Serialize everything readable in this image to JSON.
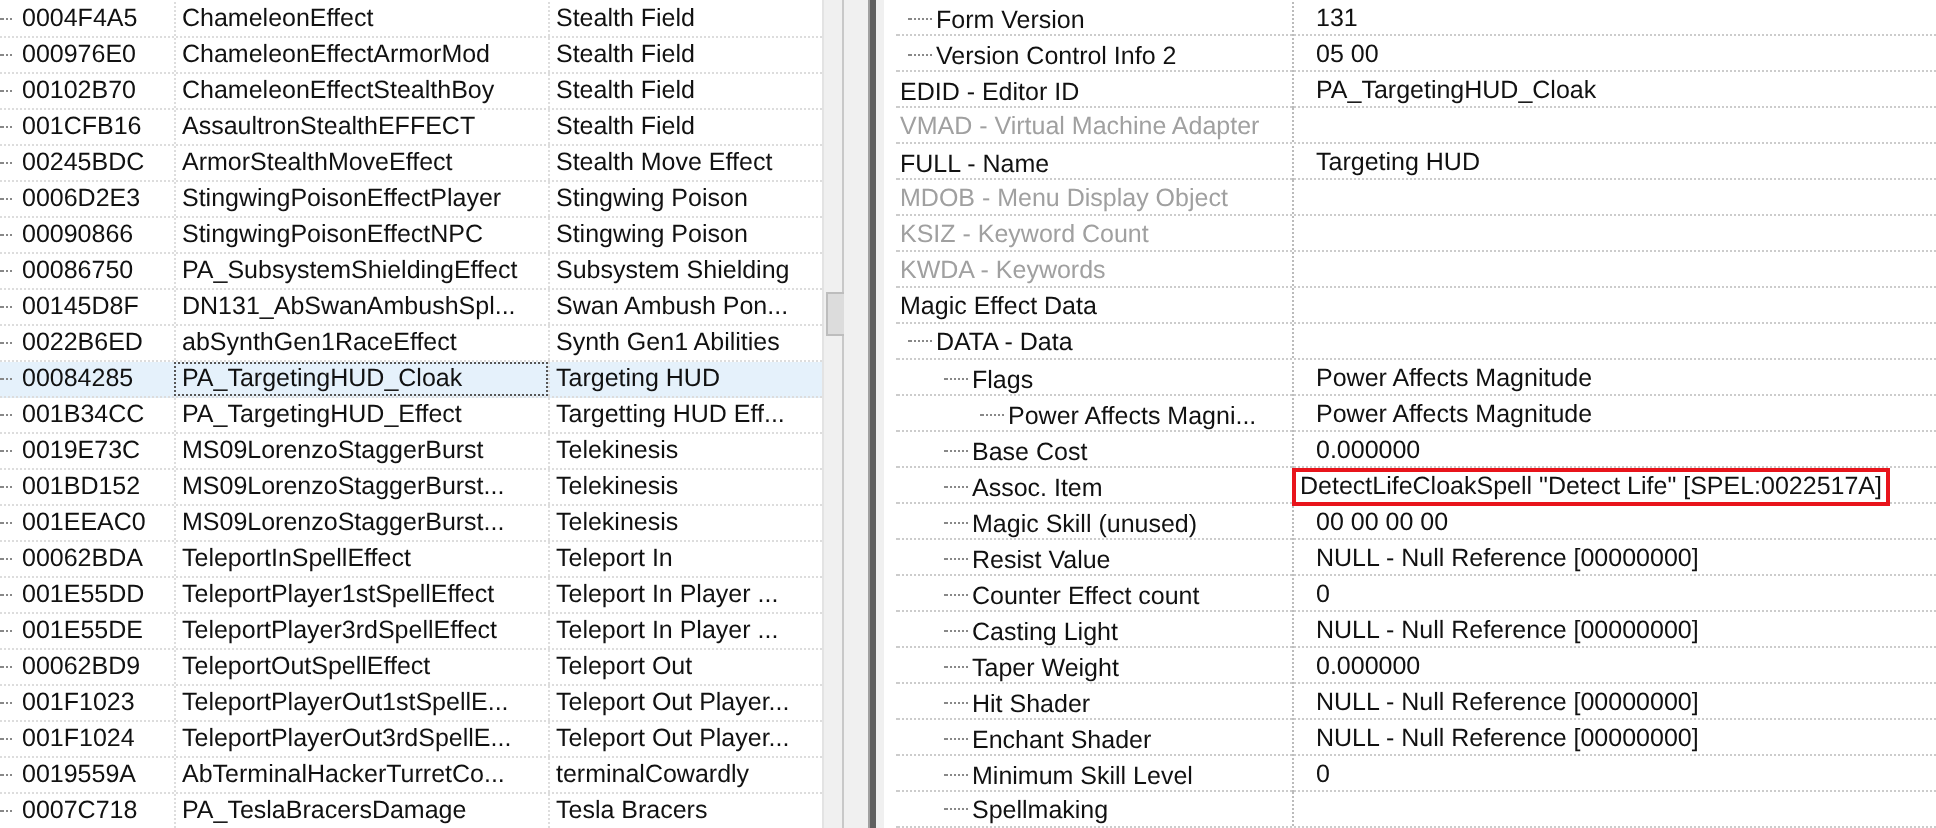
{
  "records": [
    {
      "form_id": "0004F4A5",
      "editor_id": "ChameleonEffect",
      "name": "Stealth Field",
      "selected": false
    },
    {
      "form_id": "000976E0",
      "editor_id": "ChameleonEffectArmorMod",
      "name": "Stealth Field",
      "selected": false
    },
    {
      "form_id": "00102B70",
      "editor_id": "ChameleonEffectStealthBoy",
      "name": "Stealth Field",
      "selected": false
    },
    {
      "form_id": "001CFB16",
      "editor_id": "AssaultronStealthEFFECT",
      "name": "Stealth Field",
      "selected": false
    },
    {
      "form_id": "00245BDC",
      "editor_id": "ArmorStealthMoveEffect",
      "name": "Stealth Move Effect",
      "selected": false
    },
    {
      "form_id": "0006D2E3",
      "editor_id": "StingwingPoisonEffectPlayer",
      "name": "Stingwing Poison",
      "selected": false
    },
    {
      "form_id": "00090866",
      "editor_id": "StingwingPoisonEffectNPC",
      "name": "Stingwing Poison",
      "selected": false
    },
    {
      "form_id": "00086750",
      "editor_id": "PA_SubsystemShieldingEffect",
      "name": "Subsystem Shielding",
      "selected": false
    },
    {
      "form_id": "00145D8F",
      "editor_id": "DN131_AbSwanAmbushSpl...",
      "name": "Swan Ambush Pon...",
      "selected": false
    },
    {
      "form_id": "0022B6ED",
      "editor_id": "abSynthGen1RaceEffect",
      "name": "Synth Gen1 Abilities",
      "selected": false
    },
    {
      "form_id": "00084285",
      "editor_id": "PA_TargetingHUD_Cloak",
      "name": "Targeting HUD",
      "selected": true
    },
    {
      "form_id": "001B34CC",
      "editor_id": "PA_TargetingHUD_Effect",
      "name": "Targetting HUD Eff...",
      "selected": false
    },
    {
      "form_id": "0019E73C",
      "editor_id": "MS09LorenzoStaggerBurst",
      "name": "Telekinesis",
      "selected": false
    },
    {
      "form_id": "001BD152",
      "editor_id": "MS09LorenzoStaggerBurst...",
      "name": "Telekinesis",
      "selected": false
    },
    {
      "form_id": "001EEAC0",
      "editor_id": "MS09LorenzoStaggerBurst...",
      "name": "Telekinesis",
      "selected": false
    },
    {
      "form_id": "00062BDA",
      "editor_id": "TeleportInSpellEffect",
      "name": "Teleport In",
      "selected": false
    },
    {
      "form_id": "001E55DD",
      "editor_id": "TeleportPlayer1stSpellEffect",
      "name": "Teleport In Player ...",
      "selected": false
    },
    {
      "form_id": "001E55DE",
      "editor_id": "TeleportPlayer3rdSpellEffect",
      "name": "Teleport In Player ...",
      "selected": false
    },
    {
      "form_id": "00062BD9",
      "editor_id": "TeleportOutSpellEffect",
      "name": "Teleport Out",
      "selected": false
    },
    {
      "form_id": "001F1023",
      "editor_id": "TeleportPlayerOut1stSpellE...",
      "name": "Teleport Out Player...",
      "selected": false
    },
    {
      "form_id": "001F1024",
      "editor_id": "TeleportPlayerOut3rdSpellE...",
      "name": "Teleport Out Player...",
      "selected": false
    },
    {
      "form_id": "0019559A",
      "editor_id": "AbTerminalHackerTurretCo...",
      "name": "terminalCowardly",
      "selected": false
    },
    {
      "form_id": "0007C718",
      "editor_id": "PA_TeslaBracersDamage",
      "name": "Tesla Bracers",
      "selected": false
    }
  ],
  "record_tree": {
    "continued_children": [
      {
        "label": "Form Version",
        "value": "131",
        "disabled": false
      },
      {
        "label": "Version Control Info 2",
        "value": "05 00",
        "disabled": false
      }
    ],
    "items": [
      {
        "label": "EDID - Editor ID",
        "value": "PA_TargetingHUD_Cloak",
        "disabled": false
      },
      {
        "label": "VMAD - Virtual Machine Adapter",
        "disabled": true
      },
      {
        "label": "FULL - Name",
        "value": "Targeting HUD",
        "disabled": false
      },
      {
        "label": "MDOB - Menu Display Object",
        "disabled": true
      },
      {
        "label": "KSIZ - Keyword Count",
        "disabled": true
      },
      {
        "label": "KWDA - Keywords",
        "disabled": true
      },
      {
        "label": "Magic Effect Data",
        "disabled": false,
        "children": [
          {
            "label": "DATA - Data",
            "disabled": false,
            "children": [
              {
                "label": "Flags",
                "value": "Power Affects Magnitude",
                "disabled": false,
                "children": [
                  {
                    "label": "Power Affects Magni...",
                    "value": "Power Affects Magnitude",
                    "disabled": false
                  }
                ]
              },
              {
                "label": "Base Cost",
                "value": "0.000000",
                "disabled": false
              },
              {
                "label": "Assoc. Item",
                "value": "DetectLifeCloakSpell \"Detect Life\" [SPEL:0022517A]",
                "disabled": false,
                "highlighted": true
              },
              {
                "label": "Magic Skill (unused)",
                "value": "00 00 00 00",
                "disabled": false
              },
              {
                "label": "Resist Value",
                "value": "NULL - Null Reference [00000000]",
                "disabled": false
              },
              {
                "label": "Counter Effect count",
                "value": "0",
                "disabled": false
              },
              {
                "label": "Casting Light",
                "value": "NULL - Null Reference [00000000]",
                "disabled": false
              },
              {
                "label": "Taper Weight",
                "value": "0.000000",
                "disabled": false
              },
              {
                "label": "Hit Shader",
                "value": "NULL - Null Reference [00000000]",
                "disabled": false
              },
              {
                "label": "Enchant Shader",
                "value": "NULL - Null Reference [00000000]",
                "disabled": false
              },
              {
                "label": "Minimum Skill Level",
                "value": "0",
                "disabled": false
              },
              {
                "label": "Spellmaking",
                "disabled": false
              }
            ]
          }
        ]
      }
    ]
  }
}
